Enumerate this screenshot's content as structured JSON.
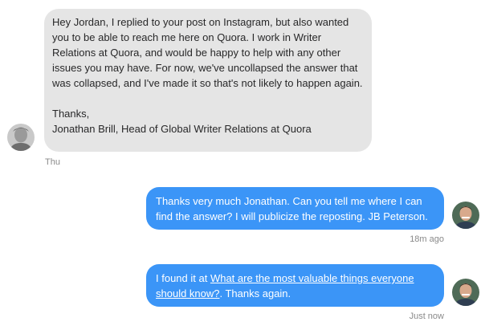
{
  "messages": [
    {
      "direction": "incoming",
      "paragraphs": [
        "Hey Jordan, I replied to your post on Instagram, but also wanted you to be able to reach me here on Quora. I work in Writer Relations at Quora, and would be happy to help with any other issues you may have. For now, we've uncollapsed the answer that was collapsed, and I've made it so that's not likely to happen again.",
        "Thanks,",
        "Jonathan Brill, Head of Global Writer Relations at Quora"
      ],
      "timestamp": "Thu",
      "avatar_icon": "avatar-jonathan-icon"
    },
    {
      "direction": "outgoing",
      "text": "Thanks very much Jonathan. Can you tell me where I can find the answer? I will publicize the reposting. JB Peterson.",
      "timestamp": "18m ago",
      "avatar_icon": "avatar-jordan-icon"
    },
    {
      "direction": "outgoing",
      "text_before": "I found it at ",
      "link_text": "What are the most valuable things everyone should know?",
      "text_after": ". Thanks again.",
      "timestamp": "Just now",
      "avatar_icon": "avatar-jordan-icon"
    }
  ],
  "colors": {
    "incoming_bubble": "#e5e5e5",
    "outgoing_bubble": "#3b95f7",
    "timestamp": "#8a8a8a"
  }
}
